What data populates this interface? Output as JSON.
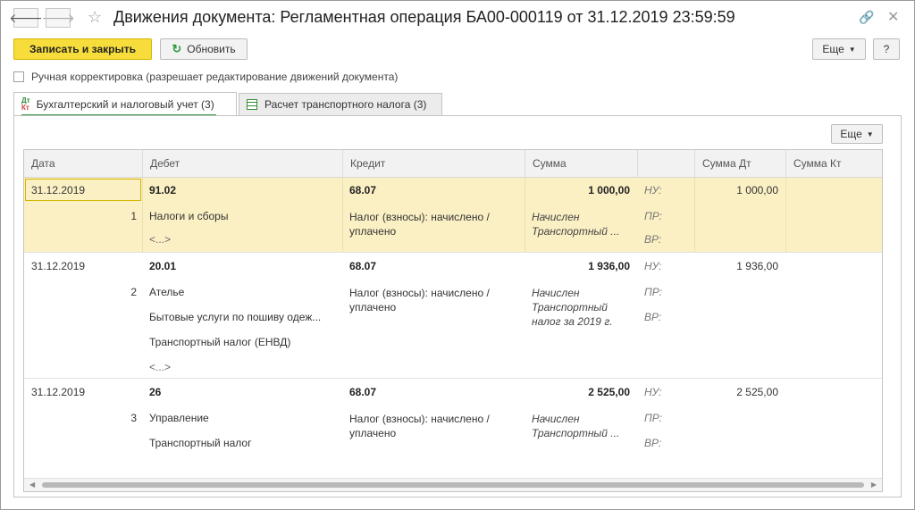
{
  "window": {
    "title": "Движения документа: Регламентная операция БА00-000119 от 31.12.2019 23:59:59",
    "back_icon": "arrow-left-icon",
    "forward_icon": "arrow-right-icon",
    "favorite_icon": "star-icon",
    "link_icon": "link-icon",
    "close_icon": "close-icon"
  },
  "toolbar": {
    "save_close_label": "Записать и закрыть",
    "refresh_label": "Обновить",
    "more_label": "Еще",
    "help_label": "?"
  },
  "manual_edit": {
    "label": "Ручная корректировка (разрешает редактирование движений документа)",
    "checked": false
  },
  "tabs": [
    {
      "label": "Бухгалтерский и налоговый учет (3)",
      "active": true
    },
    {
      "label": "Расчет транспортного налога (3)",
      "active": false
    }
  ],
  "panel": {
    "more_label": "Еще"
  },
  "table": {
    "columns": [
      "Дата",
      "Дебет",
      "Кредит",
      "Сумма",
      "",
      "Сумма Дт",
      "Сумма Кт"
    ],
    "rows": [
      {
        "date": "31.12.2019",
        "num": "1",
        "debit_account": "91.02",
        "debit_sub1": "Налоги и сборы",
        "debit_sub2": "<...>",
        "debit_sub3": "",
        "credit_account": "68.07",
        "credit_sub1": "Налог (взносы): начислено / уплачено",
        "amount": "1 000,00",
        "content": "Начислен Транспортный ...",
        "nu_label": "НУ:",
        "pr_label": "ПР:",
        "vr_label": "ВР:",
        "sum_dt": "1 000,00",
        "sum_kt": ""
      },
      {
        "date": "31.12.2019",
        "num": "2",
        "debit_account": "20.01",
        "debit_sub1": "Ателье",
        "debit_sub2": "Бытовые услуги по пошиву одеж...",
        "debit_sub3": "Транспортный налог (ЕНВД)",
        "debit_sub4": "<...>",
        "credit_account": "68.07",
        "credit_sub1": "Налог (взносы): начислено / уплачено",
        "amount": "1 936,00",
        "content": "Начислен Транспортный налог за 2019 г.",
        "nu_label": "НУ:",
        "pr_label": "ПР:",
        "vr_label": "ВР:",
        "sum_dt": "1 936,00",
        "sum_kt": ""
      },
      {
        "date": "31.12.2019",
        "num": "3",
        "debit_account": "26",
        "debit_sub1": "Управление",
        "debit_sub2": "Транспортный налог",
        "credit_account": "68.07",
        "credit_sub1": "Налог (взносы): начислено / уплачено",
        "amount": "2 525,00",
        "content": "Начислен Транспортный ...",
        "nu_label": "НУ:",
        "pr_label": "ПР:",
        "vr_label": "ВР:",
        "sum_dt": "2 525,00",
        "sum_kt": ""
      }
    ]
  },
  "colors": {
    "primary_button": "#f7dd3b",
    "selected_row": "#fbf0c4",
    "tab_accent": "#3a9a4a"
  }
}
